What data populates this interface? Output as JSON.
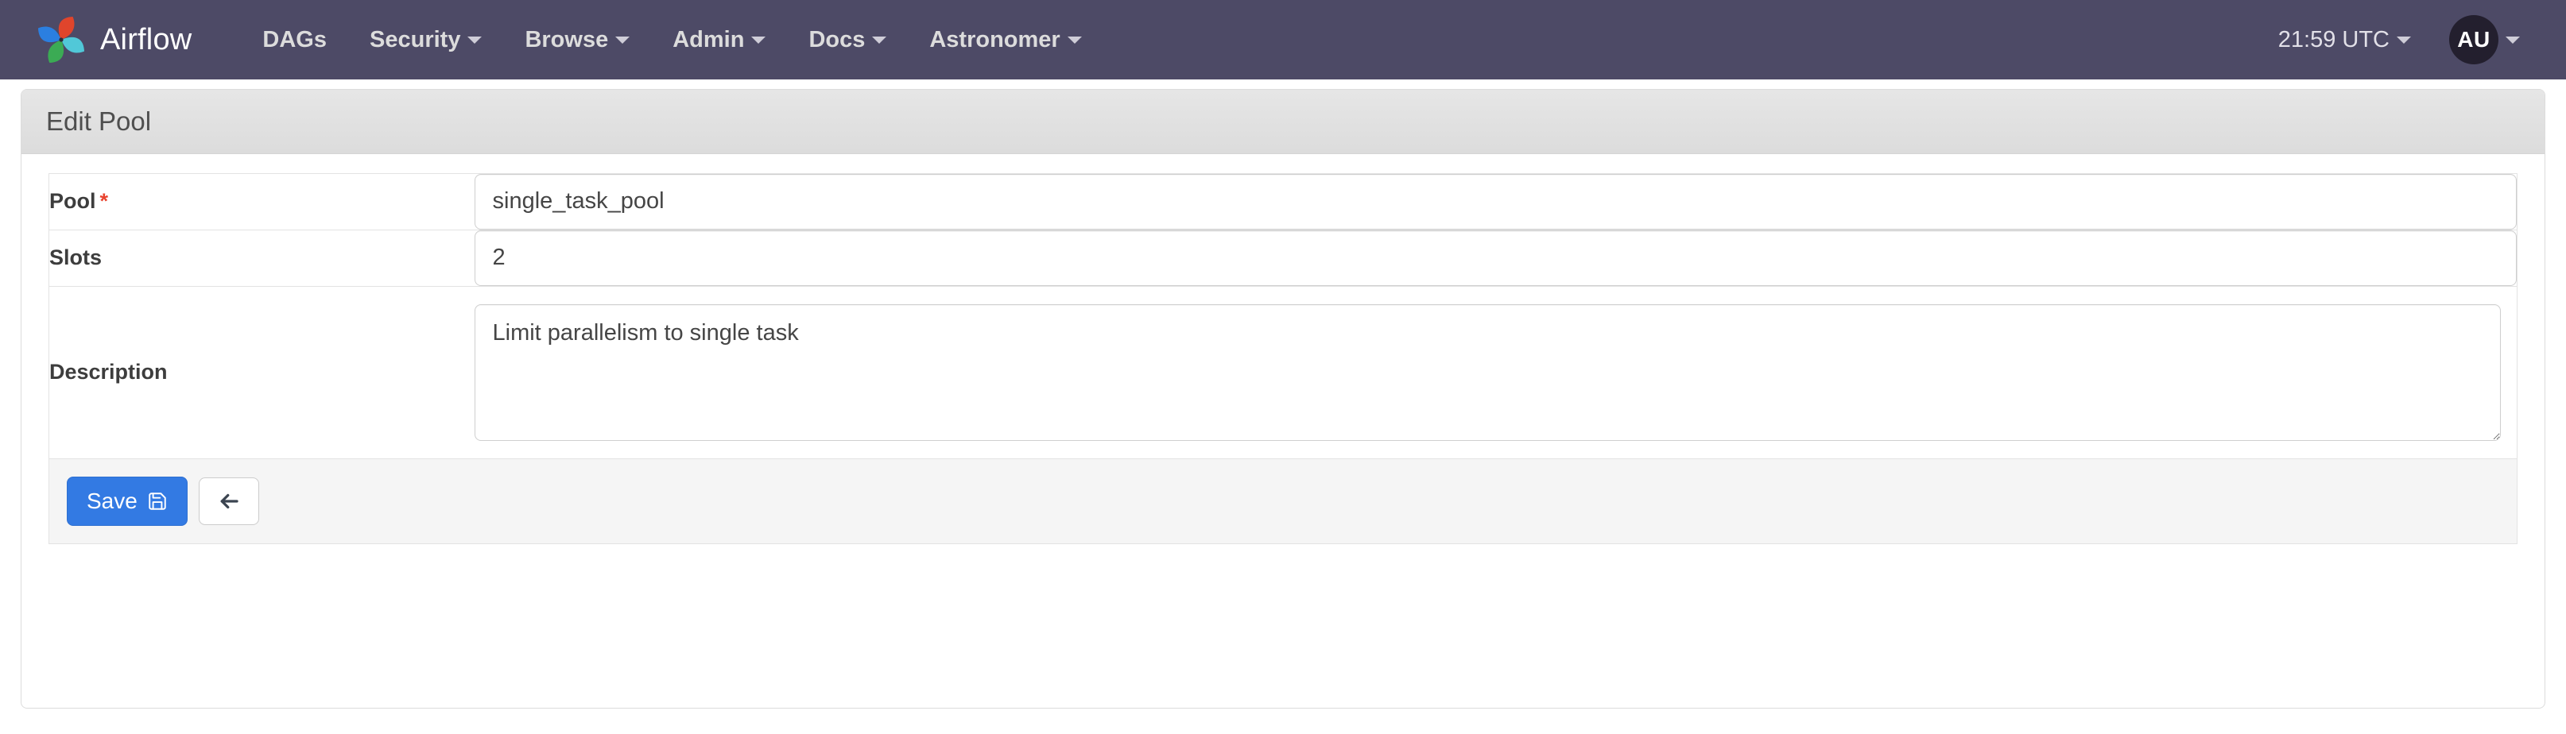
{
  "navbar": {
    "brand": {
      "label": "Airflow",
      "icon": "airflow-pinwheel-logo"
    },
    "items": [
      {
        "label": "DAGs",
        "has_dropdown": false
      },
      {
        "label": "Security",
        "has_dropdown": true
      },
      {
        "label": "Browse",
        "has_dropdown": true
      },
      {
        "label": "Admin",
        "has_dropdown": true
      },
      {
        "label": "Docs",
        "has_dropdown": true
      },
      {
        "label": "Astronomer",
        "has_dropdown": true
      }
    ],
    "clock": {
      "label": "21:59 UTC",
      "icon": "chevron-down-icon"
    },
    "user": {
      "initials": "AU",
      "icon": "chevron-down-icon"
    },
    "background_color": "#4d4a66",
    "text_color": "#dcdcdc"
  },
  "panel": {
    "title": "Edit Pool"
  },
  "form": {
    "fields": [
      {
        "label": "Pool",
        "required": true,
        "required_marker": "*",
        "value": "single_task_pool",
        "placeholder": "",
        "type": "text"
      },
      {
        "label": "Slots",
        "required": false,
        "required_marker": "",
        "value": "2",
        "placeholder": "",
        "type": "text"
      },
      {
        "label": "Description",
        "required": false,
        "required_marker": "",
        "value": "Limit parallelism to single task",
        "placeholder": "",
        "type": "textarea"
      }
    ]
  },
  "actions": {
    "save": {
      "label": "Save",
      "icon": "floppy-save-icon",
      "color": "#337ae3"
    },
    "back": {
      "label": "",
      "icon": "arrow-left-icon"
    }
  }
}
